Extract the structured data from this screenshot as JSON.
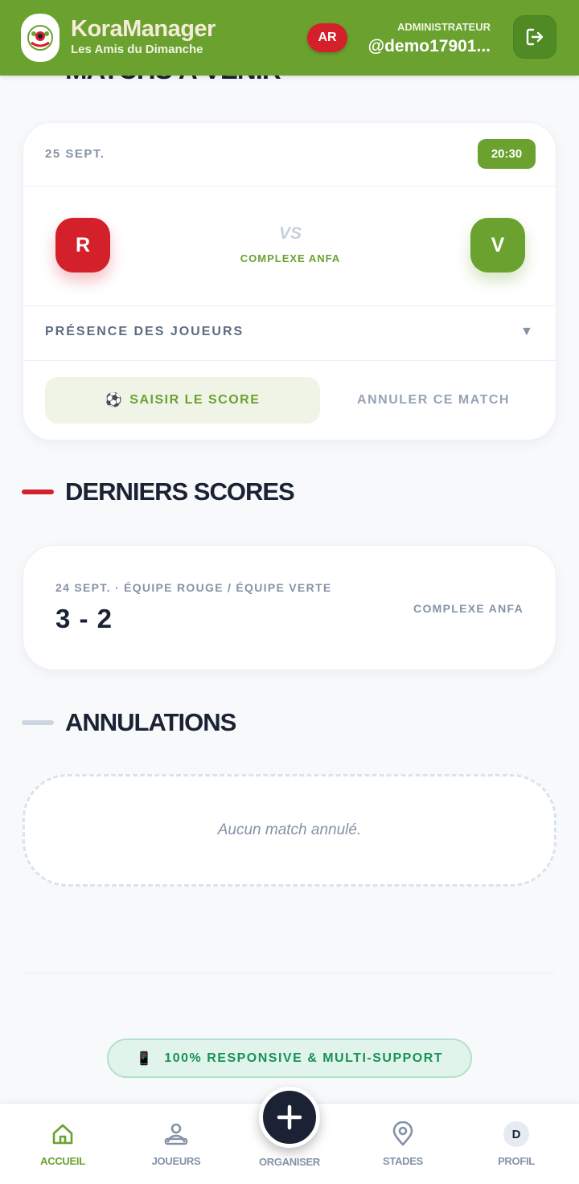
{
  "header": {
    "brand_name": "KoraManager",
    "brand_subtitle": "Les Amis du Dimanche",
    "language_badge": "AR",
    "role_label": "ADMINISTRATEUR",
    "username": "@demo17901...",
    "logout_icon": "logout-icon",
    "colors": {
      "primary": "#6aa12f",
      "danger": "#d4202b"
    }
  },
  "upcoming": {
    "section_title": "MATCHS À VENIR",
    "match": {
      "date": "25 SEPT.",
      "time": "20:30",
      "home_initial": "R",
      "away_initial": "V",
      "vs_label": "VS",
      "venue": "COMPLEXE ANFA",
      "presence_label": "PRÉSENCE DES JOUEURS",
      "presence_chevron": "▼",
      "score_button_icon": "⚽",
      "score_button_label": "SAISIR LE SCORE",
      "cancel_button_label": "ANNULER CE MATCH"
    }
  },
  "last_scores": {
    "section_title": "DERNIERS SCORES",
    "items": [
      {
        "meta": "24 SEPT. · ÉQUIPE ROUGE / ÉQUIPE VERTE",
        "score": "3 - 2",
        "venue": "COMPLEXE ANFA"
      }
    ]
  },
  "cancellations": {
    "section_title": "ANNULATIONS",
    "empty_text": "Aucun match annulé."
  },
  "footer": {
    "responsive_icon": "📱",
    "responsive_label": "100% RESPONSIVE & MULTI-SUPPORT"
  },
  "bottom_nav": {
    "items": [
      {
        "label": "ACCUEIL",
        "icon": "home-icon",
        "active": true
      },
      {
        "label": "JOUEURS",
        "icon": "players-icon",
        "active": false
      },
      {
        "label": "ORGANISER",
        "icon": "plus-icon",
        "active": false
      },
      {
        "label": "STADES",
        "icon": "location-pin-icon",
        "active": false
      },
      {
        "label": "PROFIL",
        "icon": "avatar",
        "avatar_initial": "D",
        "active": false
      }
    ]
  }
}
